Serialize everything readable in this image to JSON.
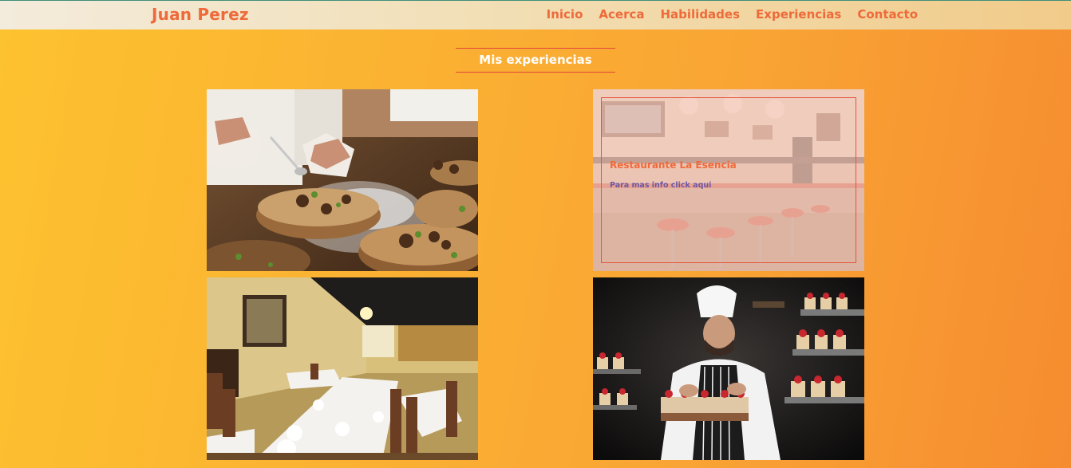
{
  "header": {
    "brand": "Juan Perez",
    "nav": [
      "Inicio",
      "Acerca",
      "Habilidades",
      "Experiencias",
      "Contacto"
    ]
  },
  "section": {
    "title": "Mis experiencias"
  },
  "cards": [
    {
      "image": "chef-plating-dish-photo"
    },
    {
      "image": "retro-diner-counter-photo",
      "overlay_title": "Restaurante La Esencia",
      "overlay_link": "Para mas info click aqui"
    },
    {
      "image": "restaurant-dining-room-photo"
    },
    {
      "image": "pastry-chef-cakes-photo"
    }
  ],
  "colors": {
    "accent": "#ee6a3a",
    "link": "#6a58a6",
    "divider": "#e0453a"
  }
}
